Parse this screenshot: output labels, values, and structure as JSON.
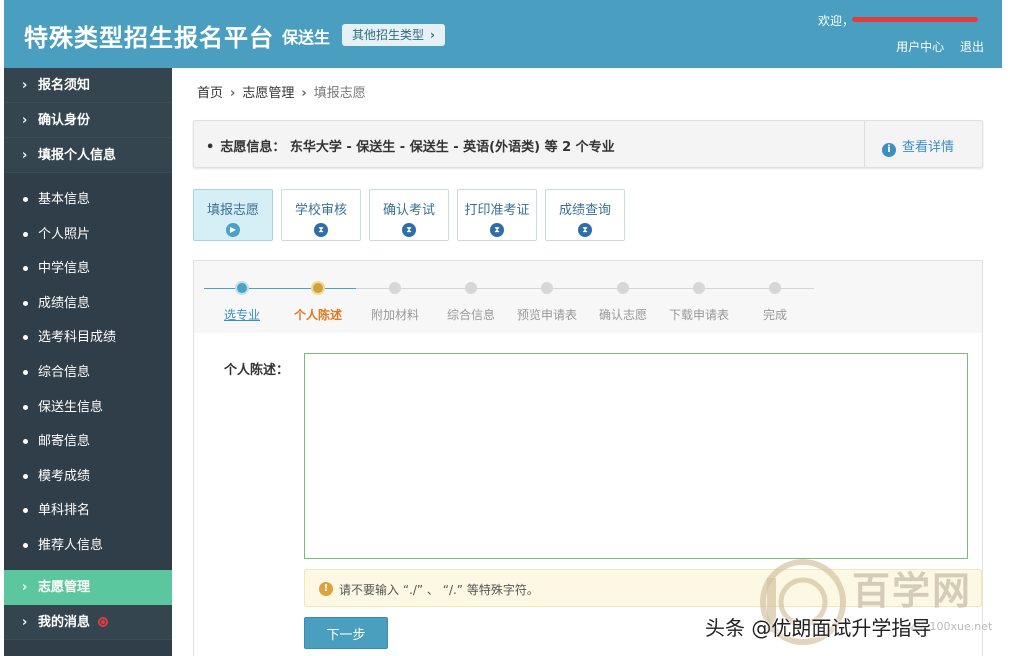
{
  "header": {
    "brand": "特殊类型招生报名平台",
    "sub": "保送生",
    "other_type": "其他招生类型",
    "welcome": "欢迎，",
    "links": [
      "用户中心",
      "退出"
    ]
  },
  "sidebar": {
    "top_items": [
      "报名须知",
      "确认身份",
      "填报个人信息"
    ],
    "sub_items": [
      "基本信息",
      "个人照片",
      "中学信息",
      "成绩信息",
      "选考科目成绩",
      "综合信息",
      "保送生信息",
      "邮寄信息",
      "模考成绩",
      "单科排名",
      "推荐人信息"
    ],
    "bottom_items": [
      "志愿管理",
      "我的消息"
    ]
  },
  "breadcrumb": [
    "首页",
    "志愿管理",
    "填报志愿"
  ],
  "info": {
    "text": "志愿信息： 东华大学 - 保送生 - 保送生 - 英语(外语类) 等 2 个专业",
    "detail": "查看详情"
  },
  "tabs": [
    "填报志愿",
    "学校审核",
    "确认考试",
    "打印准考证",
    "成绩查询"
  ],
  "progress": {
    "steps": [
      "选专业",
      "个人陈述",
      "附加材料",
      "综合信息",
      "预览申请表",
      "确认志愿",
      "下载申请表",
      "完成"
    ],
    "current_index": 1
  },
  "form": {
    "label": "个人陈述：",
    "statement_value": "",
    "warning": "请不要输入 “./” 、 “/.” 等特殊字符。",
    "next": "下一步"
  },
  "watermark": {
    "site": "百学网",
    "url": "www.100xue.net",
    "toutiao": "头条 @优朗面试升学指导"
  },
  "colors": {
    "header": "#4a9fc0",
    "sidebar": "#2f3e48",
    "sidebar_active": "#5cc79f",
    "accent_blue": "#3a8fbf",
    "current_step": "#e07a1f"
  }
}
